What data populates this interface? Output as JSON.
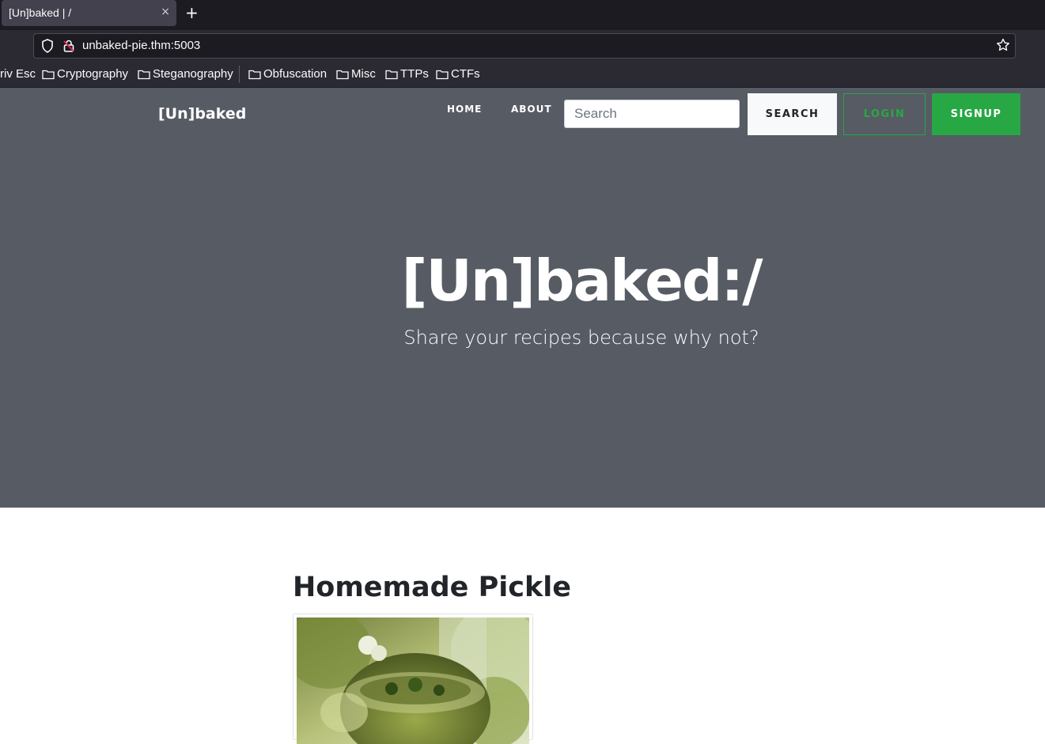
{
  "browser": {
    "tab_title": "[Un]baked | /",
    "tab_close": "×",
    "new_tab": "+",
    "url": "unbaked-pie.thm:5003",
    "bookmarks": [
      {
        "label": "riv Esc",
        "folder": false
      },
      {
        "label": "Cryptography",
        "folder": true
      },
      {
        "label": "Steganography",
        "folder": true
      },
      {
        "label": "Obfuscation",
        "folder": true
      },
      {
        "label": "Misc",
        "folder": true
      },
      {
        "label": "TTPs",
        "folder": true
      },
      {
        "label": "CTFs",
        "folder": true
      }
    ]
  },
  "site": {
    "brand": "[Un]baked",
    "nav": {
      "home": "HOME",
      "about": "ABOUT"
    },
    "search": {
      "placeholder": "Search",
      "button": "SEARCH"
    },
    "login": "LOGIN",
    "signup": "SIGNUP",
    "hero": {
      "title": "[Un]baked:/",
      "subtitle": "Share your recipes because why not?"
    },
    "colors": {
      "hero_bg": "#565b64",
      "accent": "#28a745"
    }
  },
  "content": {
    "recipe_title": "Homemade Pickle",
    "recipe_image": "pickle-jar-image"
  }
}
